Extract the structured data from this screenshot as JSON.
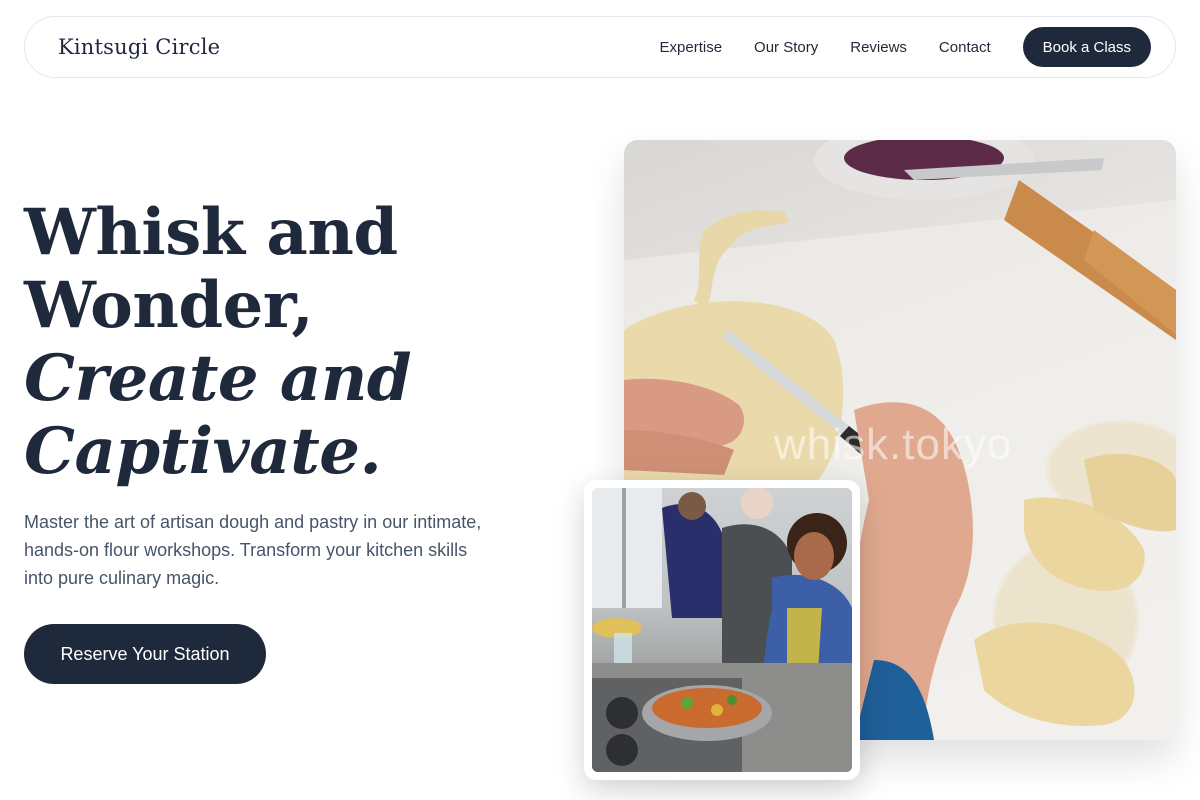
{
  "nav": {
    "brand": "Kintsugi Circle",
    "links": [
      "Expertise",
      "Our Story",
      "Reviews",
      "Contact"
    ],
    "cta": "Book a Class"
  },
  "hero": {
    "headline_line1": "Whisk and",
    "headline_line2": "Wonder,",
    "headline_line3": "Create and",
    "headline_line4": "Captivate.",
    "lead": "Master the art of artisan dough and pastry in our intimate, hands-on flour workshops. Transform your kitchen skills into pure culinary magic.",
    "button": "Reserve Your Station"
  },
  "images": {
    "main_watermark": "whisk.tokyo",
    "main_icon": "pastry-making-photo",
    "inset_icon": "cooking-class-photo"
  }
}
